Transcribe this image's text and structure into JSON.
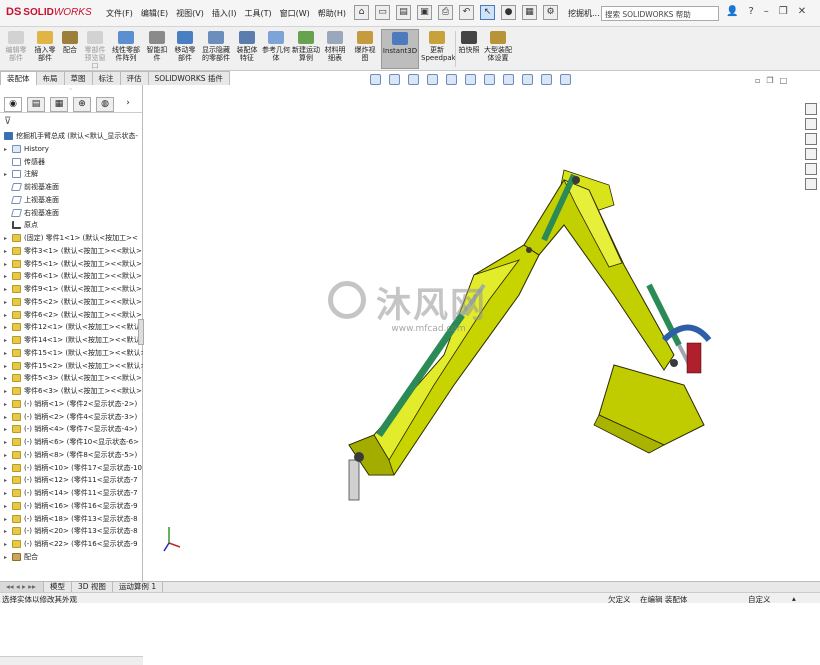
{
  "app": {
    "brand_ds": "DS",
    "brand_solid": "SOLID",
    "brand_works": "WORKS"
  },
  "menu": [
    "文件(F)",
    "编辑(E)",
    "视图(V)",
    "插入(I)",
    "工具(T)",
    "窗口(W)",
    "帮助(H)"
  ],
  "doc_name": "挖掘机...",
  "search": {
    "placeholder": "搜索 SOLIDWORKS 帮助"
  },
  "ribbon": [
    {
      "label": "编辑零部件",
      "disabled": true
    },
    {
      "label": "插入零部件",
      "disabled": false
    },
    {
      "label": "配合",
      "disabled": false
    },
    {
      "label": "零部件预览窗口",
      "disabled": true
    },
    {
      "label": "线性零部件阵列",
      "disabled": false
    },
    {
      "label": "智能扣件",
      "disabled": false
    },
    {
      "label": "移动零部件",
      "disabled": false
    },
    {
      "label": "显示隐藏的零部件",
      "disabled": false
    },
    {
      "label": "装配体特征",
      "disabled": false
    },
    {
      "label": "参考几何体",
      "disabled": false
    },
    {
      "label": "新建运动算例",
      "disabled": false
    },
    {
      "label": "材料明细表",
      "disabled": false
    },
    {
      "label": "爆炸视图",
      "disabled": false
    },
    {
      "label": "Instant3D",
      "disabled": false,
      "active": true
    },
    {
      "label": "更新Speedpak",
      "disabled": false
    },
    {
      "label": "拍快照",
      "disabled": false
    },
    {
      "label": "大型装配体设置",
      "disabled": false
    }
  ],
  "tabs": [
    "装配体",
    "布局",
    "草图",
    "标注",
    "评估",
    "SOLIDWORKS 插件"
  ],
  "tree_root": "挖掘机手臂总成 (默认<默认_显示状态-",
  "tree": [
    {
      "text": "History",
      "icon": "hist",
      "exp": "▸"
    },
    {
      "text": "传感器",
      "icon": "sens",
      "exp": ""
    },
    {
      "text": "注解",
      "icon": "ann",
      "exp": "▸"
    },
    {
      "text": "前视基准面",
      "icon": "plane",
      "exp": ""
    },
    {
      "text": "上视基准面",
      "icon": "plane",
      "exp": ""
    },
    {
      "text": "右视基准面",
      "icon": "plane",
      "exp": ""
    },
    {
      "text": "原点",
      "icon": "orig",
      "exp": ""
    },
    {
      "text": "(固定) 零件1<1> (默认<按加工><",
      "icon": "part",
      "exp": "▸"
    },
    {
      "text": "零件3<1> (默认<按加工><<默认>",
      "icon": "part",
      "exp": "▸"
    },
    {
      "text": "零件5<1> (默认<按加工><<默认>",
      "icon": "part",
      "exp": "▸"
    },
    {
      "text": "零件6<1> (默认<按加工><<默认>",
      "icon": "part",
      "exp": "▸"
    },
    {
      "text": "零件9<1> (默认<按加工><<默认>",
      "icon": "part",
      "exp": "▸"
    },
    {
      "text": "零件5<2> (默认<按加工><<默认>",
      "icon": "part",
      "exp": "▸"
    },
    {
      "text": "零件6<2> (默认<按加工><<默认>",
      "icon": "part",
      "exp": "▸"
    },
    {
      "text": "零件12<1> (默认<按加工><<默认>",
      "icon": "part",
      "exp": "▸"
    },
    {
      "text": "零件14<1> (默认<按加工><<默认>",
      "icon": "part",
      "exp": "▸"
    },
    {
      "text": "零件15<1> (默认<按加工><<默认>",
      "icon": "part",
      "exp": "▸"
    },
    {
      "text": "零件15<2> (默认<按加工><<默认>",
      "icon": "part",
      "exp": "▸"
    },
    {
      "text": "零件5<3> (默认<按加工><<默认>",
      "icon": "part",
      "exp": "▸"
    },
    {
      "text": "零件6<3> (默认<按加工><<默认>",
      "icon": "part",
      "exp": "▸"
    },
    {
      "text": "(-) 销柄<1> (零件2<显示状态-2>)",
      "icon": "part",
      "exp": "▸"
    },
    {
      "text": "(-) 销柄<2> (零件4<显示状态-3>)",
      "icon": "part",
      "exp": "▸"
    },
    {
      "text": "(-) 销柄<4> (零件7<显示状态-4>)",
      "icon": "part",
      "exp": "▸"
    },
    {
      "text": "(-) 销柄<6> (零件10<显示状态-6>",
      "icon": "part",
      "exp": "▸"
    },
    {
      "text": "(-) 销柄<8> (零件8<显示状态-5>)",
      "icon": "part",
      "exp": "▸"
    },
    {
      "text": "(-) 销柄<10> (零件17<显示状态-10",
      "icon": "part",
      "exp": "▸"
    },
    {
      "text": "(-) 销柄<12> (零件11<显示状态-7",
      "icon": "part",
      "exp": "▸"
    },
    {
      "text": "(-) 销柄<14> (零件11<显示状态-7",
      "icon": "part",
      "exp": "▸"
    },
    {
      "text": "(-) 销柄<16> (零件16<显示状态-9",
      "icon": "part",
      "exp": "▸"
    },
    {
      "text": "(-) 销柄<18> (零件13<显示状态-8",
      "icon": "part",
      "exp": "▸"
    },
    {
      "text": "(-) 销柄<20> (零件13<显示状态-8",
      "icon": "part",
      "exp": "▸"
    },
    {
      "text": "(-) 销柄<22> (零件16<显示状态-9",
      "icon": "part",
      "exp": "▸"
    },
    {
      "text": "配合",
      "icon": "mate",
      "exp": "▸"
    }
  ],
  "watermark": {
    "cn": "沐风网",
    "url": "www.mfcad.com"
  },
  "bottom_tabs": [
    "模型",
    "3D 视图",
    "运动算例 1"
  ],
  "status": {
    "left": "选择实体以修改其外观",
    "undef": "欠定义",
    "editing": "在编辑 装配体",
    "custom": "自定义"
  }
}
